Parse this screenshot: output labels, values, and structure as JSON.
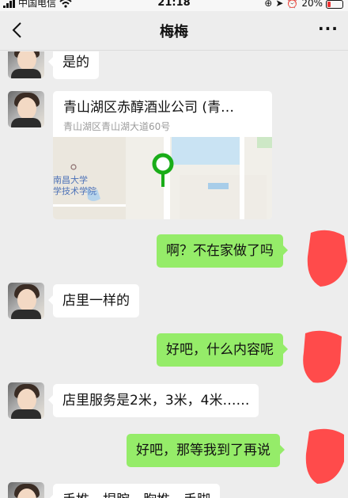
{
  "status_bar": {
    "carrier": "中国电信",
    "time": "21:18",
    "battery": "20%"
  },
  "nav": {
    "title": "梅梅",
    "more": "···"
  },
  "messages": [
    {
      "side": "in",
      "text": "是的"
    },
    {
      "side": "in",
      "type": "location",
      "title": "青山湖区赤醇酒业公司 (青…",
      "address": "青山湖区青山湖大道60号",
      "map_label_1": "南昌大学",
      "map_label_2": "学技术学院"
    },
    {
      "side": "out",
      "text": "啊？不在家做了吗"
    },
    {
      "side": "in",
      "text": "店里一样的"
    },
    {
      "side": "out",
      "text": "好吧，什么内容呢"
    },
    {
      "side": "in",
      "text": "店里服务是2米，3米，4米……"
    },
    {
      "side": "out",
      "text": "好吧，那等我到了再说"
    },
    {
      "side": "in",
      "text": "手推，捏腕，胸推，手脚"
    }
  ],
  "colors": {
    "outgoing_bubble": "#95ec69",
    "incoming_bubble": "#ffffff",
    "background": "#ededed",
    "map_pin": "#1aad19",
    "redaction": "#ff4b4b"
  }
}
